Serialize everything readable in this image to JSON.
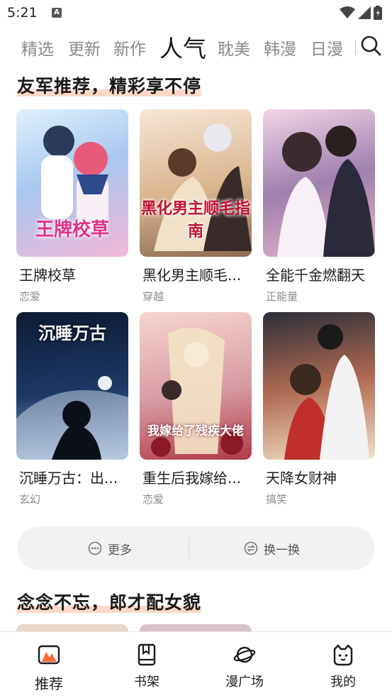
{
  "status_bar": {
    "time": "5:21",
    "app_icon": "A"
  },
  "tabs": [
    {
      "label": "精选",
      "active": false
    },
    {
      "label": "更新",
      "active": false
    },
    {
      "label": "新作",
      "active": false
    },
    {
      "label": "人气",
      "active": true
    },
    {
      "label": "耽美",
      "active": false
    },
    {
      "label": "韩漫",
      "active": false
    },
    {
      "label": "日漫",
      "active": false
    }
  ],
  "sections": [
    {
      "title": "友军推荐，精彩享不停",
      "items": [
        {
          "title": "王牌校草",
          "tag": "恋爱",
          "cover_text": "王牌校草",
          "cover_colors": [
            "#dff0fb",
            "#a9c8ef",
            "#f2b7d6"
          ]
        },
        {
          "title": "黑化男主顺毛...",
          "tag": "穿越",
          "cover_text": "黑化男主顺毛指南",
          "cover_colors": [
            "#f6e6d8",
            "#d9b58c",
            "#8c6a52"
          ]
        },
        {
          "title": "全能千金燃翻天",
          "tag": "正能量",
          "cover_text": "",
          "cover_colors": [
            "#f1d7e6",
            "#9f7fae",
            "#e7b6c9"
          ]
        },
        {
          "title": "沉睡万古：出...",
          "tag": "玄幻",
          "cover_text": "沉睡万古",
          "cover_colors": [
            "#0e1a33",
            "#1d3a66",
            "#9fb6d6"
          ]
        },
        {
          "title": "重生后我嫁给...",
          "tag": "恋爱",
          "cover_text": "我嫁给了残疾大佬",
          "cover_colors": [
            "#f5d6cf",
            "#d79aa3",
            "#b03a48"
          ]
        },
        {
          "title": "天降女财神",
          "tag": "搞笑",
          "cover_text": "",
          "cover_colors": [
            "#2b2f3a",
            "#b06a52",
            "#f3e2c7"
          ]
        }
      ]
    },
    {
      "title": "念念不忘，郎才配女貌"
    }
  ],
  "actions": {
    "more_label": "更多",
    "refresh_label": "换一换"
  },
  "bottom_nav": [
    {
      "label": "推荐",
      "icon": "recommend-icon",
      "active": true
    },
    {
      "label": "书架",
      "icon": "bookshelf-icon",
      "active": false
    },
    {
      "label": "漫广场",
      "icon": "planet-icon",
      "active": false
    },
    {
      "label": "我的",
      "icon": "profile-cat-icon",
      "active": false
    }
  ],
  "colors": {
    "accent": "#ff6a3d",
    "highlight": "#ffd8c8",
    "cover_title": "#e0338a"
  }
}
